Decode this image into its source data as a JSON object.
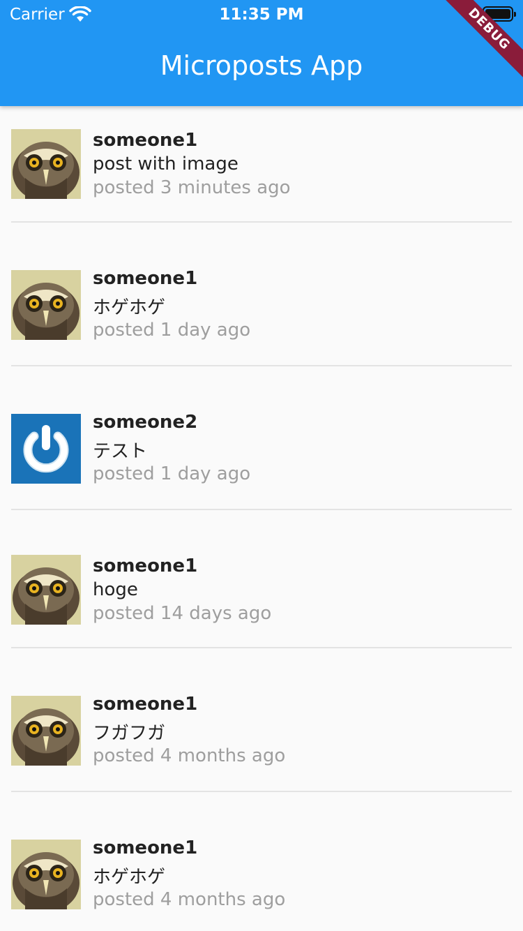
{
  "status_bar": {
    "carrier": "Carrier",
    "time": "11:35 PM"
  },
  "app_bar": {
    "title": "Microposts App",
    "debug_banner": "DEBUG",
    "color": "#2196f3"
  },
  "posts": [
    {
      "user": "someone1",
      "content": "post with image",
      "posted": "posted 3 minutes ago",
      "avatar": "owl-avatar"
    },
    {
      "user": "someone1",
      "content": "ホゲホゲ",
      "posted": "posted 1 day ago",
      "avatar": "owl-avatar"
    },
    {
      "user": "someone2",
      "content": "テスト",
      "posted": "posted 1 day ago",
      "avatar": "power-avatar"
    },
    {
      "user": "someone1",
      "content": "hoge",
      "posted": "posted 14 days ago",
      "avatar": "owl-avatar"
    },
    {
      "user": "someone1",
      "content": "フガフガ",
      "posted": "posted 4 months ago",
      "avatar": "owl-avatar"
    },
    {
      "user": "someone1",
      "content": "ホゲホゲ",
      "posted": "posted 4 months ago",
      "avatar": "owl-avatar"
    }
  ]
}
